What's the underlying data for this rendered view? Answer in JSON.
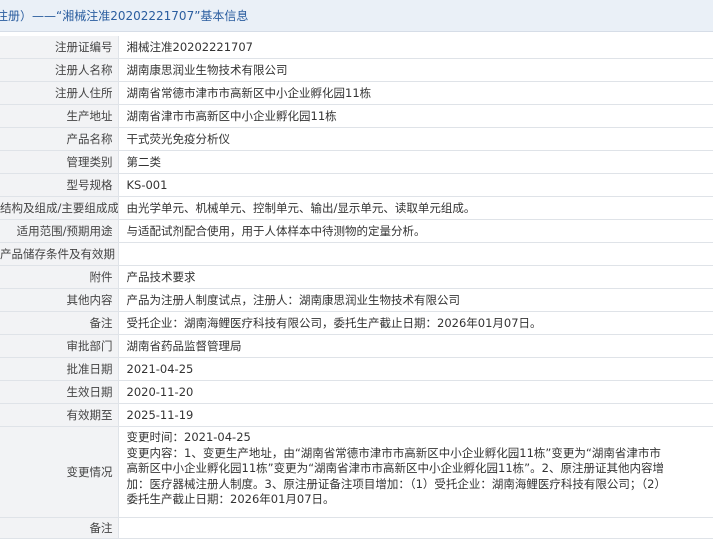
{
  "header": {
    "title": "注册）——“湘械注准20202221707”基本信息"
  },
  "rows": [
    {
      "label": "注册证编号",
      "value": "湘械注准20202221707"
    },
    {
      "label": "注册人名称",
      "value": "湖南康思润业生物技术有限公司"
    },
    {
      "label": "注册人住所",
      "value": "湖南省常德市津市市高新区中小企业孵化园11栋"
    },
    {
      "label": "生产地址",
      "value": "湖南省津市市高新区中小企业孵化园11栋"
    },
    {
      "label": "产品名称",
      "value": "干式荧光免疫分析仪"
    },
    {
      "label": "管理类别",
      "value": "第二类"
    },
    {
      "label": "型号规格",
      "value": "KS-001"
    },
    {
      "label": "结构及组成/主要组成成分",
      "value": "由光学单元、机械单元、控制单元、输出/显示单元、读取单元组成。"
    },
    {
      "label": "适用范围/预期用途",
      "value": "与适配试剂配合使用，用于人体样本中待测物的定量分析。"
    },
    {
      "label": "产品储存条件及有效期",
      "value": ""
    },
    {
      "label": "附件",
      "value": "产品技术要求"
    },
    {
      "label": "其他内容",
      "value": "产品为注册人制度试点，注册人：湖南康思润业生物技术有限公司"
    },
    {
      "label": "备注",
      "value": "受托企业：湖南海鲤医疗科技有限公司，委托生产截止日期：2026年01月07日。"
    },
    {
      "label": "审批部门",
      "value": "湖南省药品监督管理局"
    },
    {
      "label": "批准日期",
      "value": "2021-04-25"
    },
    {
      "label": "生效日期",
      "value": "2020-11-20"
    },
    {
      "label": "有效期至",
      "value": "2025-11-19"
    }
  ],
  "change": {
    "label": "变更情况",
    "lines": [
      "变更时间：2021-04-25",
      "变更内容：1、变更生产地址，由“湖南省常德市津市市高新区中小企业孵化园11栋”变更为“湖南省津市市",
      "高新区中小企业孵化园11栋”变更为“湖南省津市市高新区中小企业孵化园11栋”。2、原注册证其他内容增",
      "加：医疗器械注册人制度。3、原注册证备注项目增加：（1）受托企业：湖南海鲤医疗科技有限公司；（2）",
      "委托生产截止日期：2026年01月07日。"
    ]
  },
  "last_row_label": "备注"
}
